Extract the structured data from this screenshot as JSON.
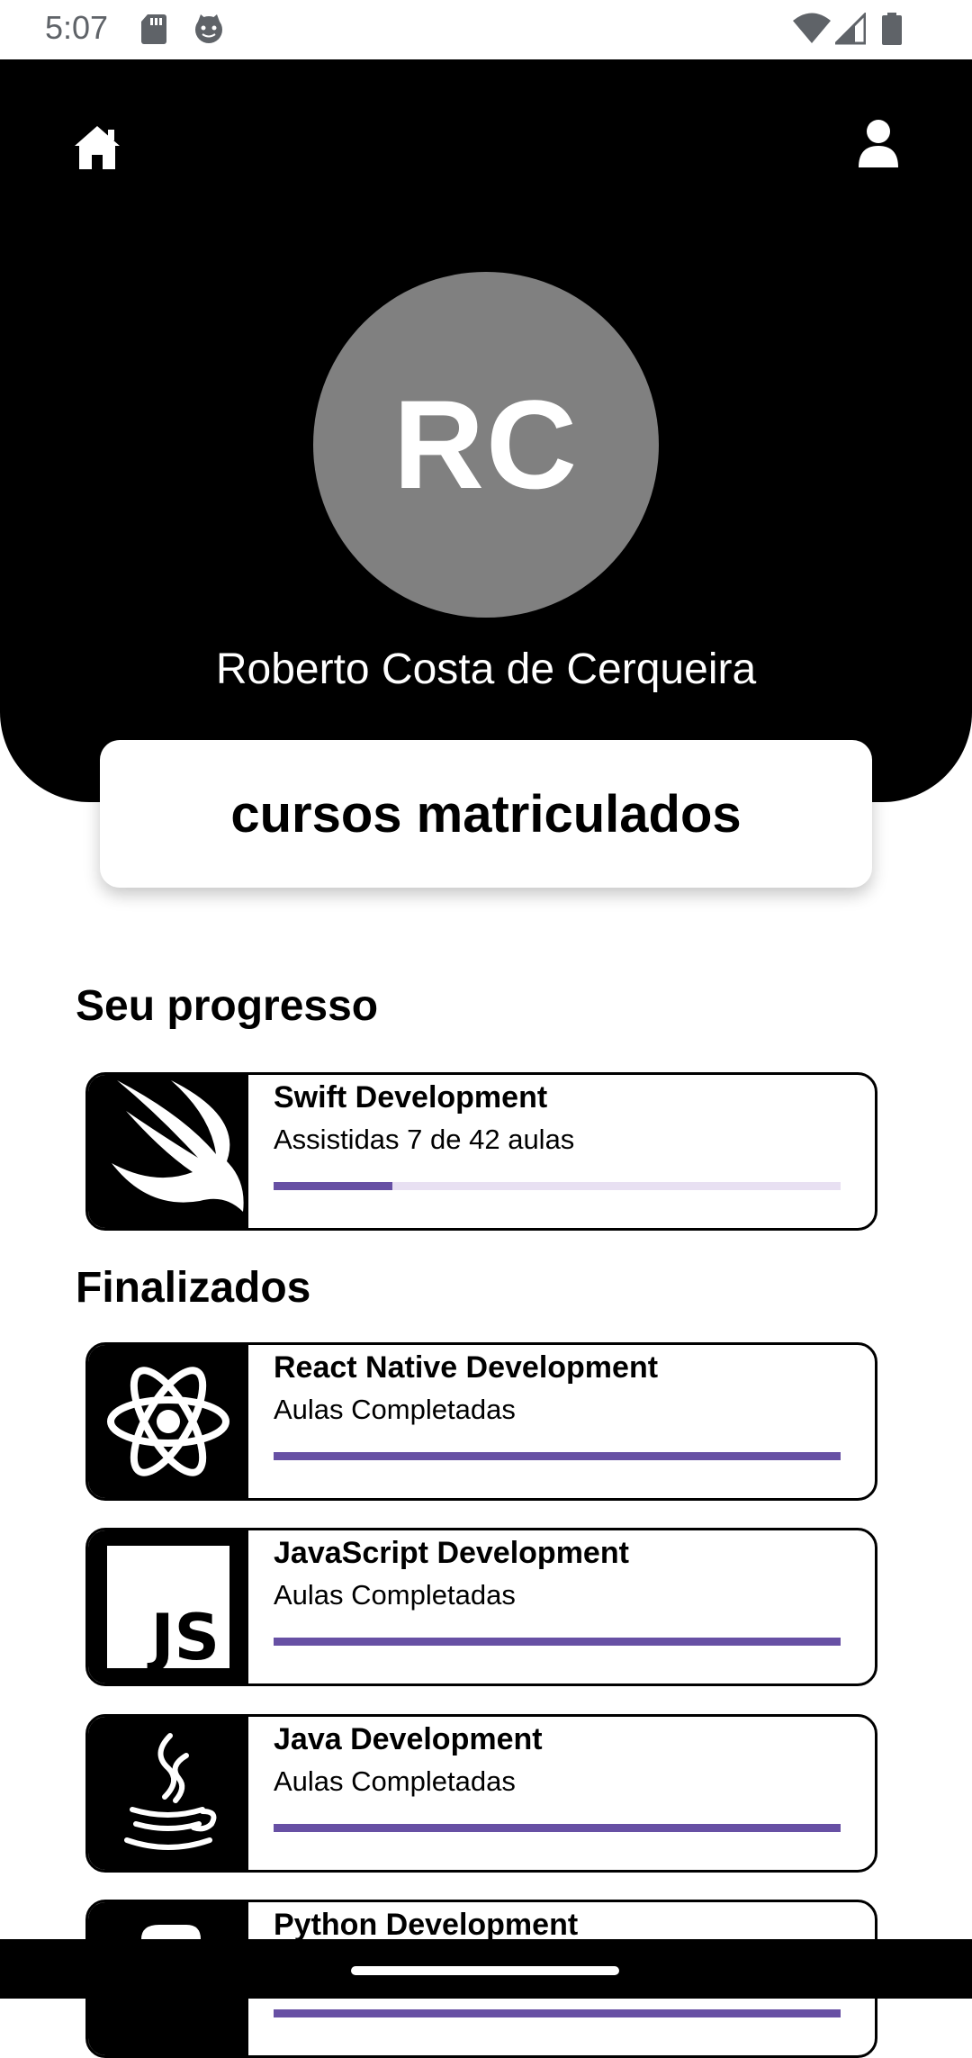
{
  "status_bar": {
    "time": "5:07"
  },
  "header": {
    "avatar_initials": "RC",
    "user_name": "Roberto Costa de Cerqueira"
  },
  "enrolled_card": {
    "label": "cursos matriculados"
  },
  "progress_section": {
    "title": "Seu progresso",
    "courses": [
      {
        "title": "Swift Development",
        "subtitle": "Assistidas 7 de 42 aulas",
        "icon": "swift-icon",
        "progress": 0.21
      }
    ]
  },
  "finished_section": {
    "title": "Finalizados",
    "courses": [
      {
        "title": "React Native Development",
        "subtitle": "Aulas Completadas",
        "icon": "react-icon",
        "progress": 1.0
      },
      {
        "title": "JavaScript Development",
        "subtitle": "Aulas Completadas",
        "icon": "javascript-icon",
        "progress": 1.0
      },
      {
        "title": "Java Development",
        "subtitle": "Aulas Completadas",
        "icon": "java-icon",
        "progress": 1.0
      },
      {
        "title": "Python Development",
        "subtitle": "",
        "icon": "python-icon",
        "progress": 1.0
      }
    ]
  },
  "colors": {
    "accent": "#6750a4",
    "track": "#e8e0f2",
    "avatar": "#808080",
    "header": "#000000"
  }
}
